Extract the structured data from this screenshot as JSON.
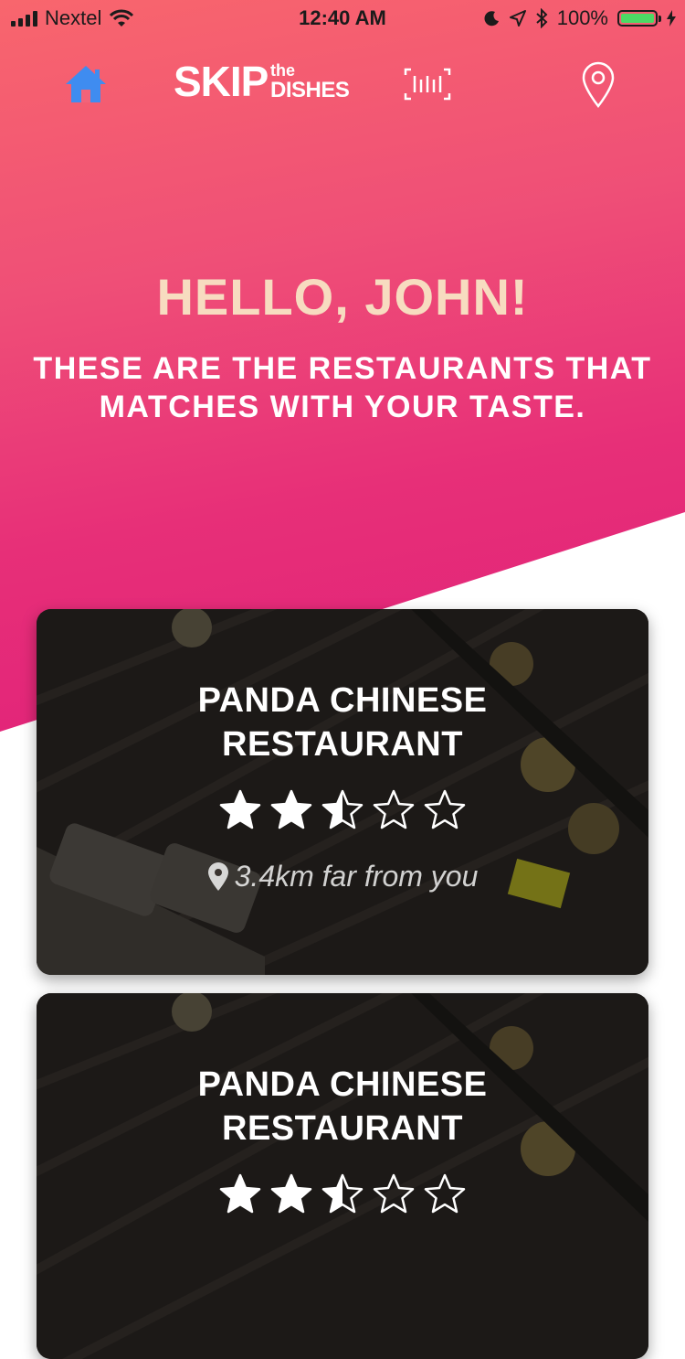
{
  "status_bar": {
    "carrier": "Nextel",
    "time": "12:40 AM",
    "battery": "100%",
    "battery_level": 1.0
  },
  "nav": {
    "logo_main": "SKIP",
    "logo_the": "the",
    "logo_dishes": "DISHES",
    "icons": [
      "home-icon",
      "scan-icon",
      "location-pin-icon"
    ]
  },
  "header": {
    "greeting": "HELLO, JOHN!",
    "subtitle_line1": "THESE ARE THE RESTAURANTS THAT",
    "subtitle_line2": "MATCHES WITH YOUR TASTE."
  },
  "restaurants": [
    {
      "name_line1": "PANDA CHINESE",
      "name_line2": "RESTAURANT",
      "rating": 2.5,
      "rating_max": 5,
      "distance": "3.4km far from you"
    },
    {
      "name_line1": "PANDA CHINESE",
      "name_line2": "RESTAURANT",
      "rating": 2.5,
      "rating_max": 5,
      "distance": ""
    }
  ],
  "colors": {
    "gradient_start": "#f8666d",
    "gradient_end": "#e0207a",
    "greeting": "#f7dcc0",
    "home_active": "#3f8cf0"
  }
}
